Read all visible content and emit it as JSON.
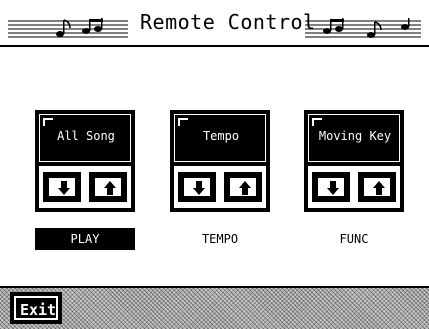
{
  "header": {
    "title": "Remote Control"
  },
  "panels": [
    {
      "name": "All Song",
      "caption": "PLAY",
      "selected": true
    },
    {
      "name": "Tempo",
      "caption": "TEMPO",
      "selected": false
    },
    {
      "name": "Moving Key",
      "caption": "FUNC",
      "selected": false
    }
  ],
  "footer": {
    "exit_label": "Exit"
  },
  "icons": {
    "staff_left": "music-staff-icon",
    "staff_right": "music-staff-icon",
    "down": "arrow-down-icon",
    "up": "arrow-up-icon"
  }
}
